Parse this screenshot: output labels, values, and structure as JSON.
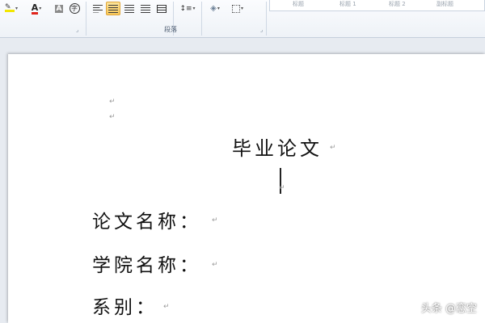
{
  "ribbon": {
    "paragraph_group_label": "段落",
    "style_previews": [
      "标题",
      "标题 1",
      "标题 2",
      "副标题"
    ]
  },
  "document": {
    "title": "毕业论文",
    "fields": [
      {
        "label": "论文名称："
      },
      {
        "label": "学院名称："
      },
      {
        "label": "系别："
      }
    ],
    "paragraph_mark": "↵"
  },
  "watermark": "头条 @恋空"
}
